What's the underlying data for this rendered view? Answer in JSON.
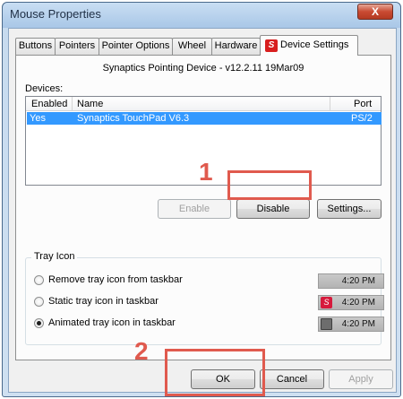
{
  "window": {
    "title": "Mouse Properties",
    "close_glyph": "X"
  },
  "tabs": [
    {
      "label": "Buttons"
    },
    {
      "label": "Pointers"
    },
    {
      "label": "Pointer Options"
    },
    {
      "label": "Wheel"
    },
    {
      "label": "Hardware"
    },
    {
      "label": "Device Settings",
      "active": true,
      "icon": "synaptics-icon"
    }
  ],
  "device_settings": {
    "title": "Synaptics Pointing Device - v12.2.11 19Mar09",
    "devices_label": "Devices:",
    "columns": {
      "enabled": "Enabled",
      "name": "Name",
      "port": "Port"
    },
    "rows": [
      {
        "enabled": "Yes",
        "name": "Synaptics TouchPad V6.3",
        "port": "PS/2",
        "selected": true
      }
    ],
    "buttons": {
      "enable": "Enable",
      "disable": "Disable",
      "settings": "Settings..."
    }
  },
  "tray_icon": {
    "legend": "Tray Icon",
    "options": [
      {
        "label": "Remove tray icon from taskbar",
        "checked": false,
        "time": "4:20 PM",
        "icon": "none"
      },
      {
        "label": "Static tray icon in taskbar",
        "checked": false,
        "time": "4:20 PM",
        "icon": "synaptics-red-icon"
      },
      {
        "label": "Animated tray icon in taskbar",
        "checked": true,
        "time": "4:20 PM",
        "icon": "touchpad-gray-icon"
      }
    ]
  },
  "dialog_buttons": {
    "ok": "OK",
    "cancel": "Cancel",
    "apply": "Apply"
  },
  "annotations": {
    "step1": "1",
    "step2": "2",
    "color": "#e05a4e"
  }
}
